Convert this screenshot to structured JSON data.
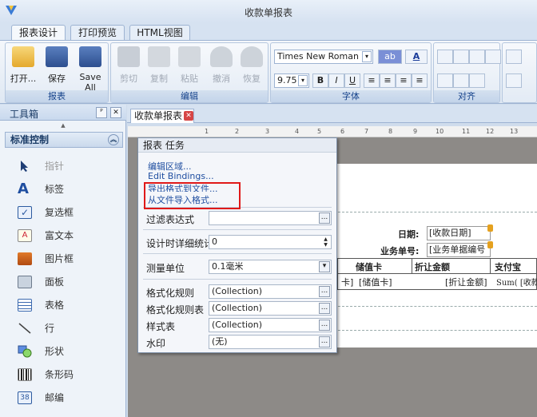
{
  "window": {
    "title": "收款单报表"
  },
  "ribbon": {
    "tabs": [
      "报表设计",
      "打印预览",
      "HTML视图"
    ],
    "groups": {
      "report": {
        "label": "报表",
        "open": "打开...",
        "save": "保存",
        "save_all": "Save All"
      },
      "edit": {
        "label": "编辑",
        "cut": "剪切",
        "copy": "复制",
        "paste": "粘贴",
        "undo": "撤消",
        "redo": "恢复"
      },
      "font": {
        "label": "字体",
        "font_name": "Times New Roman",
        "font_size": "9.75",
        "bold": "B",
        "italic": "I",
        "underline": "U",
        "font_color": "A"
      },
      "align": {
        "label": "对齐"
      }
    }
  },
  "toolbox": {
    "title": "工具箱",
    "pin": "ᴾ",
    "close": "✕",
    "category": "标准控制",
    "items": [
      "指针",
      "标签",
      "复选框",
      "富文本",
      "图片框",
      "面板",
      "表格",
      "行",
      "形状",
      "条形码",
      "邮编"
    ]
  },
  "document": {
    "tab_title": "收款单报表",
    "ruler": [
      "1",
      "2",
      "3",
      "4",
      "5",
      "6",
      "7",
      "8",
      "9",
      "10",
      "11",
      "12",
      "13"
    ],
    "fields": {
      "date_label": "日期:",
      "date_value": "[收款日期]",
      "bizno_label": "业务单号:",
      "bizno_value": "[业务单据编号",
      "col_stored_card": "储值卡",
      "col_discount_amount": "折让金额",
      "col_alipay": "支付宝",
      "cell_card": "卡]",
      "cell_stored_card": "[储值卡]",
      "cell_discount": "[折让金额]",
      "cell_sum": "Sum( [收款"
    }
  },
  "tasks_panel": {
    "title": "报表 任务",
    "links": [
      "编辑区域...",
      "Edit Bindings...",
      "导出格式到文件...",
      "从文件导入格式..."
    ],
    "properties": [
      {
        "label": "过滤表达式",
        "value": ""
      },
      {
        "label": "设计时详细统计",
        "value": "0"
      },
      {
        "label": "测量单位",
        "value": "0.1毫米"
      },
      {
        "label": "格式化规则",
        "value": "(Collection)"
      },
      {
        "label": "格式化规则表",
        "value": "(Collection)"
      },
      {
        "label": "样式表",
        "value": "(Collection)"
      },
      {
        "label": "水印",
        "value": "(无)"
      }
    ],
    "ellipsis": "..."
  },
  "colors": {
    "accent": "#15428b",
    "highlight": "#e01919"
  }
}
